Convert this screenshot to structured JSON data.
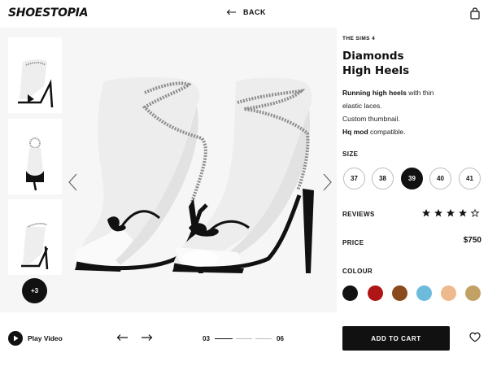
{
  "header": {
    "logo": "SHOESTOPIA",
    "back_label": "BACK",
    "bag_icon": "shopping-bag-icon"
  },
  "gallery": {
    "thumbnails": [
      "sandal-side-view",
      "sandal-back-view",
      "sandal-pair-view"
    ],
    "more_label": "+3",
    "prev_icon": "chevron-left-icon",
    "next_icon": "chevron-right-icon"
  },
  "product": {
    "eyebrow": "THE SIMS 4",
    "title_line1": "Diamonds",
    "title_line2": "High Heels",
    "desc_bold1": "Running high heels",
    "desc_text1": " with thin",
    "desc_line2": "elastic laces.",
    "desc_line3": "Custom thumbnail.",
    "desc_bold4": "Hq mod",
    "desc_text4": " compatible."
  },
  "size": {
    "label": "SIZE",
    "options": [
      "37",
      "38",
      "39",
      "40",
      "41"
    ],
    "selected": "39"
  },
  "reviews": {
    "label": "REVIEWS",
    "rating": 4,
    "max": 5
  },
  "price": {
    "label": "PRICE",
    "value": "$750"
  },
  "colour": {
    "label": "COLOUR",
    "swatches": [
      "#111111",
      "#b01515",
      "#8a4a1c",
      "#6cbbdc",
      "#efb98e",
      "#c2a264"
    ]
  },
  "footer": {
    "play_label": "Play Video",
    "page_current": "03",
    "page_total": "06",
    "cart_label": "ADD TO CART",
    "heart_icon": "heart-icon"
  }
}
